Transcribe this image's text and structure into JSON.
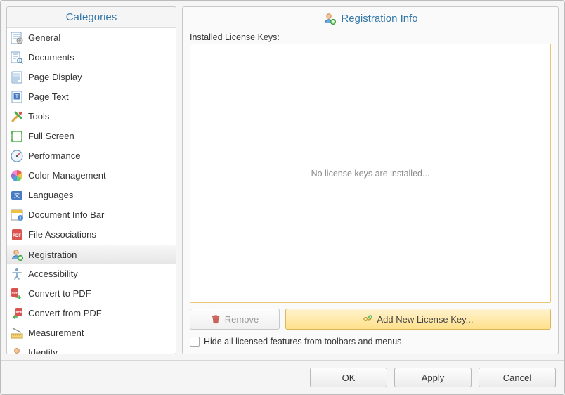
{
  "sidebar": {
    "header": "Categories",
    "selected_index": 11,
    "items": [
      {
        "label": "General",
        "icon": "settings-sheet-icon"
      },
      {
        "label": "Documents",
        "icon": "document-magnify-icon"
      },
      {
        "label": "Page Display",
        "icon": "page-display-icon"
      },
      {
        "label": "Page Text",
        "icon": "page-text-icon"
      },
      {
        "label": "Tools",
        "icon": "tools-icon"
      },
      {
        "label": "Full Screen",
        "icon": "fullscreen-icon"
      },
      {
        "label": "Performance",
        "icon": "gauge-icon"
      },
      {
        "label": "Color Management",
        "icon": "color-wheel-icon"
      },
      {
        "label": "Languages",
        "icon": "languages-icon"
      },
      {
        "label": "Document Info Bar",
        "icon": "info-bar-icon"
      },
      {
        "label": "File Associations",
        "icon": "pdf-file-icon"
      },
      {
        "label": "Registration",
        "icon": "user-add-icon"
      },
      {
        "label": "Accessibility",
        "icon": "accessibility-icon"
      },
      {
        "label": "Convert to PDF",
        "icon": "convert-to-pdf-icon"
      },
      {
        "label": "Convert from PDF",
        "icon": "convert-from-pdf-icon"
      },
      {
        "label": "Measurement",
        "icon": "ruler-icon"
      },
      {
        "label": "Identity",
        "icon": "identity-icon"
      }
    ]
  },
  "main": {
    "header": "Registration Info",
    "header_icon": "user-add-icon",
    "installed_label": "Installed License Keys:",
    "empty_text": "No license keys are installed...",
    "remove_label": "Remove",
    "remove_icon": "trash-icon",
    "add_label": "Add New License Key...",
    "add_icon": "key-add-icon",
    "hide_checkbox_label": "Hide all licensed features from toolbars and menus",
    "hide_checkbox_checked": false
  },
  "footer": {
    "ok": "OK",
    "apply": "Apply",
    "cancel": "Cancel"
  },
  "icons": {
    "settings-sheet-icon": "<svg viewBox='0 0 20 20'><rect x='2' y='2' width='14' height='16' rx='1' fill='#fff' stroke='#7aa3c9'/><path d='M4 5h10M4 8h10M4 11h7' stroke='#7aa3c9'/><circle cx='14' cy='14' r='4' fill='#d0d0d0' stroke='#888'/><path d='M14 12v4M12 14h4' stroke='#888'/></svg>",
    "document-magnify-icon": "<svg viewBox='0 0 20 20'><rect x='2' y='2' width='12' height='15' rx='1' fill='#fff' stroke='#7aa3c9'/><path d='M4 5h8M4 8h8M4 11h5' stroke='#7aa3c9'/><circle cx='14' cy='14' r='3.2' fill='none' stroke='#5b8fbd' stroke-width='1.4'/><path d='M16.5 16.5l2 2' stroke='#5b8fbd' stroke-width='1.6'/></svg>",
    "page-display-icon": "<svg viewBox='0 0 20 20'><rect x='3' y='2' width='14' height='16' rx='1' fill='#fff' stroke='#7aa3c9'/><rect x='5' y='4' width='10' height='5' fill='#cfe3f5'/><path d='M5 11h10M5 13h10M5 15h6' stroke='#7aa3c9'/></svg>",
    "page-text-icon": "<svg viewBox='0 0 20 20'><rect x='3' y='2' width='14' height='16' rx='1' fill='#fff' stroke='#7aa3c9'/><rect x='5.5' y='4.5' width='9' height='9' fill='#4a7cc2'/><text x='10' y='11.5' text-anchor='middle' font-size='8' fill='#fff' font-family='serif'>T</text></svg>",
    "tools-icon": "<svg viewBox='0 0 20 20'><path d='M4 16 L12 8' stroke='#e4a336' stroke-width='3' stroke-linecap='round'/><path d='M8 4 L16 12' stroke='#4cae4c' stroke-width='3' stroke-linecap='round'/><circle cx='15' cy='5' r='2.2' fill='#d9534f'/></svg>",
    "fullscreen-icon": "<svg viewBox='0 0 20 20'><rect x='3' y='3' width='14' height='14' fill='none' stroke='#4cae4c' stroke-width='1.4'/><path d='M3 6V3h3M17 6V3h-3M3 14v3h3M17 14v3h-3' stroke='#4cae4c' stroke-width='1.6' fill='none'/></svg>",
    "gauge-icon": "<svg viewBox='0 0 20 20'><circle cx='10' cy='10' r='8' fill='#eef4fb' stroke='#5b8fbd'/><path d='M10 10 L14 6' stroke='#d9534f' stroke-width='1.6'/><circle cx='10' cy='10' r='1.2' fill='#555'/></svg>",
    "color-wheel-icon": "<svg viewBox='0 0 20 20'><g transform='translate(10,10)'><path d='M0 0 L0 -8 A8 8 0 0 1 6.9 -4 Z' fill='#f15a5a'/><path d='M0 0 L6.9 -4 A8 8 0 0 1 6.9 4 Z' fill='#f5c23e'/><path d='M0 0 L6.9 4 A8 8 0 0 1 0 8 Z' fill='#6fcf6f'/><path d='M0 0 L0 8 A8 8 0 0 1 -6.9 4 Z' fill='#4aa3df'/><path d='M0 0 L-6.9 4 A8 8 0 0 1 -6.9 -4 Z' fill='#8e6fd1'/><path d='M0 0 L-6.9 -4 A8 8 0 0 1 0 -8 Z' fill='#f58ad0'/></g></svg>",
    "languages-icon": "<svg viewBox='0 0 20 20'><rect x='2' y='4' width='16' height='12' rx='2' fill='#4a7cc2'/><text x='10' y='13' text-anchor='middle' font-size='8' fill='#fff'>文</text></svg>",
    "info-bar-icon": "<svg viewBox='0 0 20 20'><rect x='2' y='3' width='16' height='14' rx='1' fill='#fff' stroke='#999'/><rect x='2' y='3' width='16' height='4' fill='#f0c040'/><circle cx='15' cy='14' r='4' fill='#4a90d9'/><text x='15' y='16.5' text-anchor='middle' font-size='6.5' fill='#fff' font-weight='bold'>i</text></svg>",
    "pdf-file-icon": "<svg viewBox='0 0 20 20'><rect x='3' y='2' width='14' height='16' rx='2' fill='#d9534f'/><text x='10' y='13' text-anchor='middle' font-size='6' fill='#fff' font-weight='bold'>PDF</text></svg>",
    "user-add-icon": "<svg viewBox='0 0 20 20'><circle cx='9' cy='7' r='3.2' fill='#f3c79a' stroke='#c98b50'/><path d='M3.5 17c0-3 2.5-5.2 5.5-5.2s5.5 2.2 5.5 5.2' fill='#6ea7da' stroke='#3d77ab'/><circle cx='15' cy='15' r='3.6' fill='#6fcf6f' stroke='#3f9c3f'/><path d='M15 13v4M13 15h4' stroke='#fff' stroke-width='1.4'/></svg>",
    "accessibility-icon": "<svg viewBox='0 0 20 20'><circle cx='10' cy='4' r='2' fill='#7aa3c9'/><path d='M4 8h12M10 8v5M10 13l-3 4M10 13l3 4' stroke='#7aa3c9' stroke-width='1.6' fill='none' stroke-linecap='round'/></svg>",
    "convert-to-pdf-icon": "<svg viewBox='0 0 20 20'><rect x='2' y='2' width='10' height='12' rx='1.5' fill='#d9534f'/><text x='7' y='10' text-anchor='middle' font-size='4.5' fill='#fff' font-weight='bold'>PDF</text><path d='M9 15h6m0 0-2-2m2 2-2 2' stroke='#4cae4c' stroke-width='1.6' fill='none' stroke-linecap='round'/></svg>",
    "convert-from-pdf-icon": "<svg viewBox='0 0 20 20'><rect x='8' y='2' width='10' height='12' rx='1.5' fill='#d9534f'/><text x='13' y='10' text-anchor='middle' font-size='4.5' fill='#fff' font-weight='bold'>PDF</text><path d='M11 15H5m0 0 2-2m-2 2 2 2' stroke='#4cae4c' stroke-width='1.6' fill='none' stroke-linecap='round'/></svg>",
    "ruler-icon": "<svg viewBox='0 0 20 20'><rect x='2' y='11' width='16' height='6' fill='#f5d47a' stroke='#c9a23e'/><path d='M5 11v3M8 11v3M11 11v3M14 11v3' stroke='#c9a23e'/><path d='M4 3l12 6' stroke='#888' stroke-width='1.3'/></svg>",
    "identity-icon": "<svg viewBox='0 0 20 20'><circle cx='10' cy='7' r='3.4' fill='#f3c79a' stroke='#c98b50'/><path d='M3.5 18c0-3.4 2.9-6 6.5-6s6.5 2.6 6.5 6' fill='#bfa0d9' stroke='#8e6fb4'/></svg>",
    "trash-icon": "<svg viewBox='0 0 16 16'><path d='M3 5h10l-1 9a1 1 0 0 1-1 1H5a1 1 0 0 1-1-1L3 5z' fill='#c9635a'/><rect x='2' y='3' width='12' height='2' rx='0.5' fill='#c9635a'/><rect x='6' y='1.5' width='4' height='2' rx='0.5' fill='#c9635a'/></svg>",
    "key-add-icon": "<svg viewBox='0 0 16 16'><circle cx='5' cy='8' r='3' fill='#e7c24a' stroke='#b8922c'/><circle cx='5' cy='8' r='1.1' fill='#fff'/><path d='M7.5 8h6v2h-1.5v-1h-1v1.5H9.5V8' fill='#e7c24a' stroke='#b8922c' stroke-width='0.6'/><circle cx='12.5' cy='4.5' r='2.6' fill='#6fcf6f' stroke='#3f9c3f'/><path d='M12.5 3.2v2.6M11.2 4.5h2.6' stroke='#fff' stroke-width='1.1'/></svg>"
  }
}
